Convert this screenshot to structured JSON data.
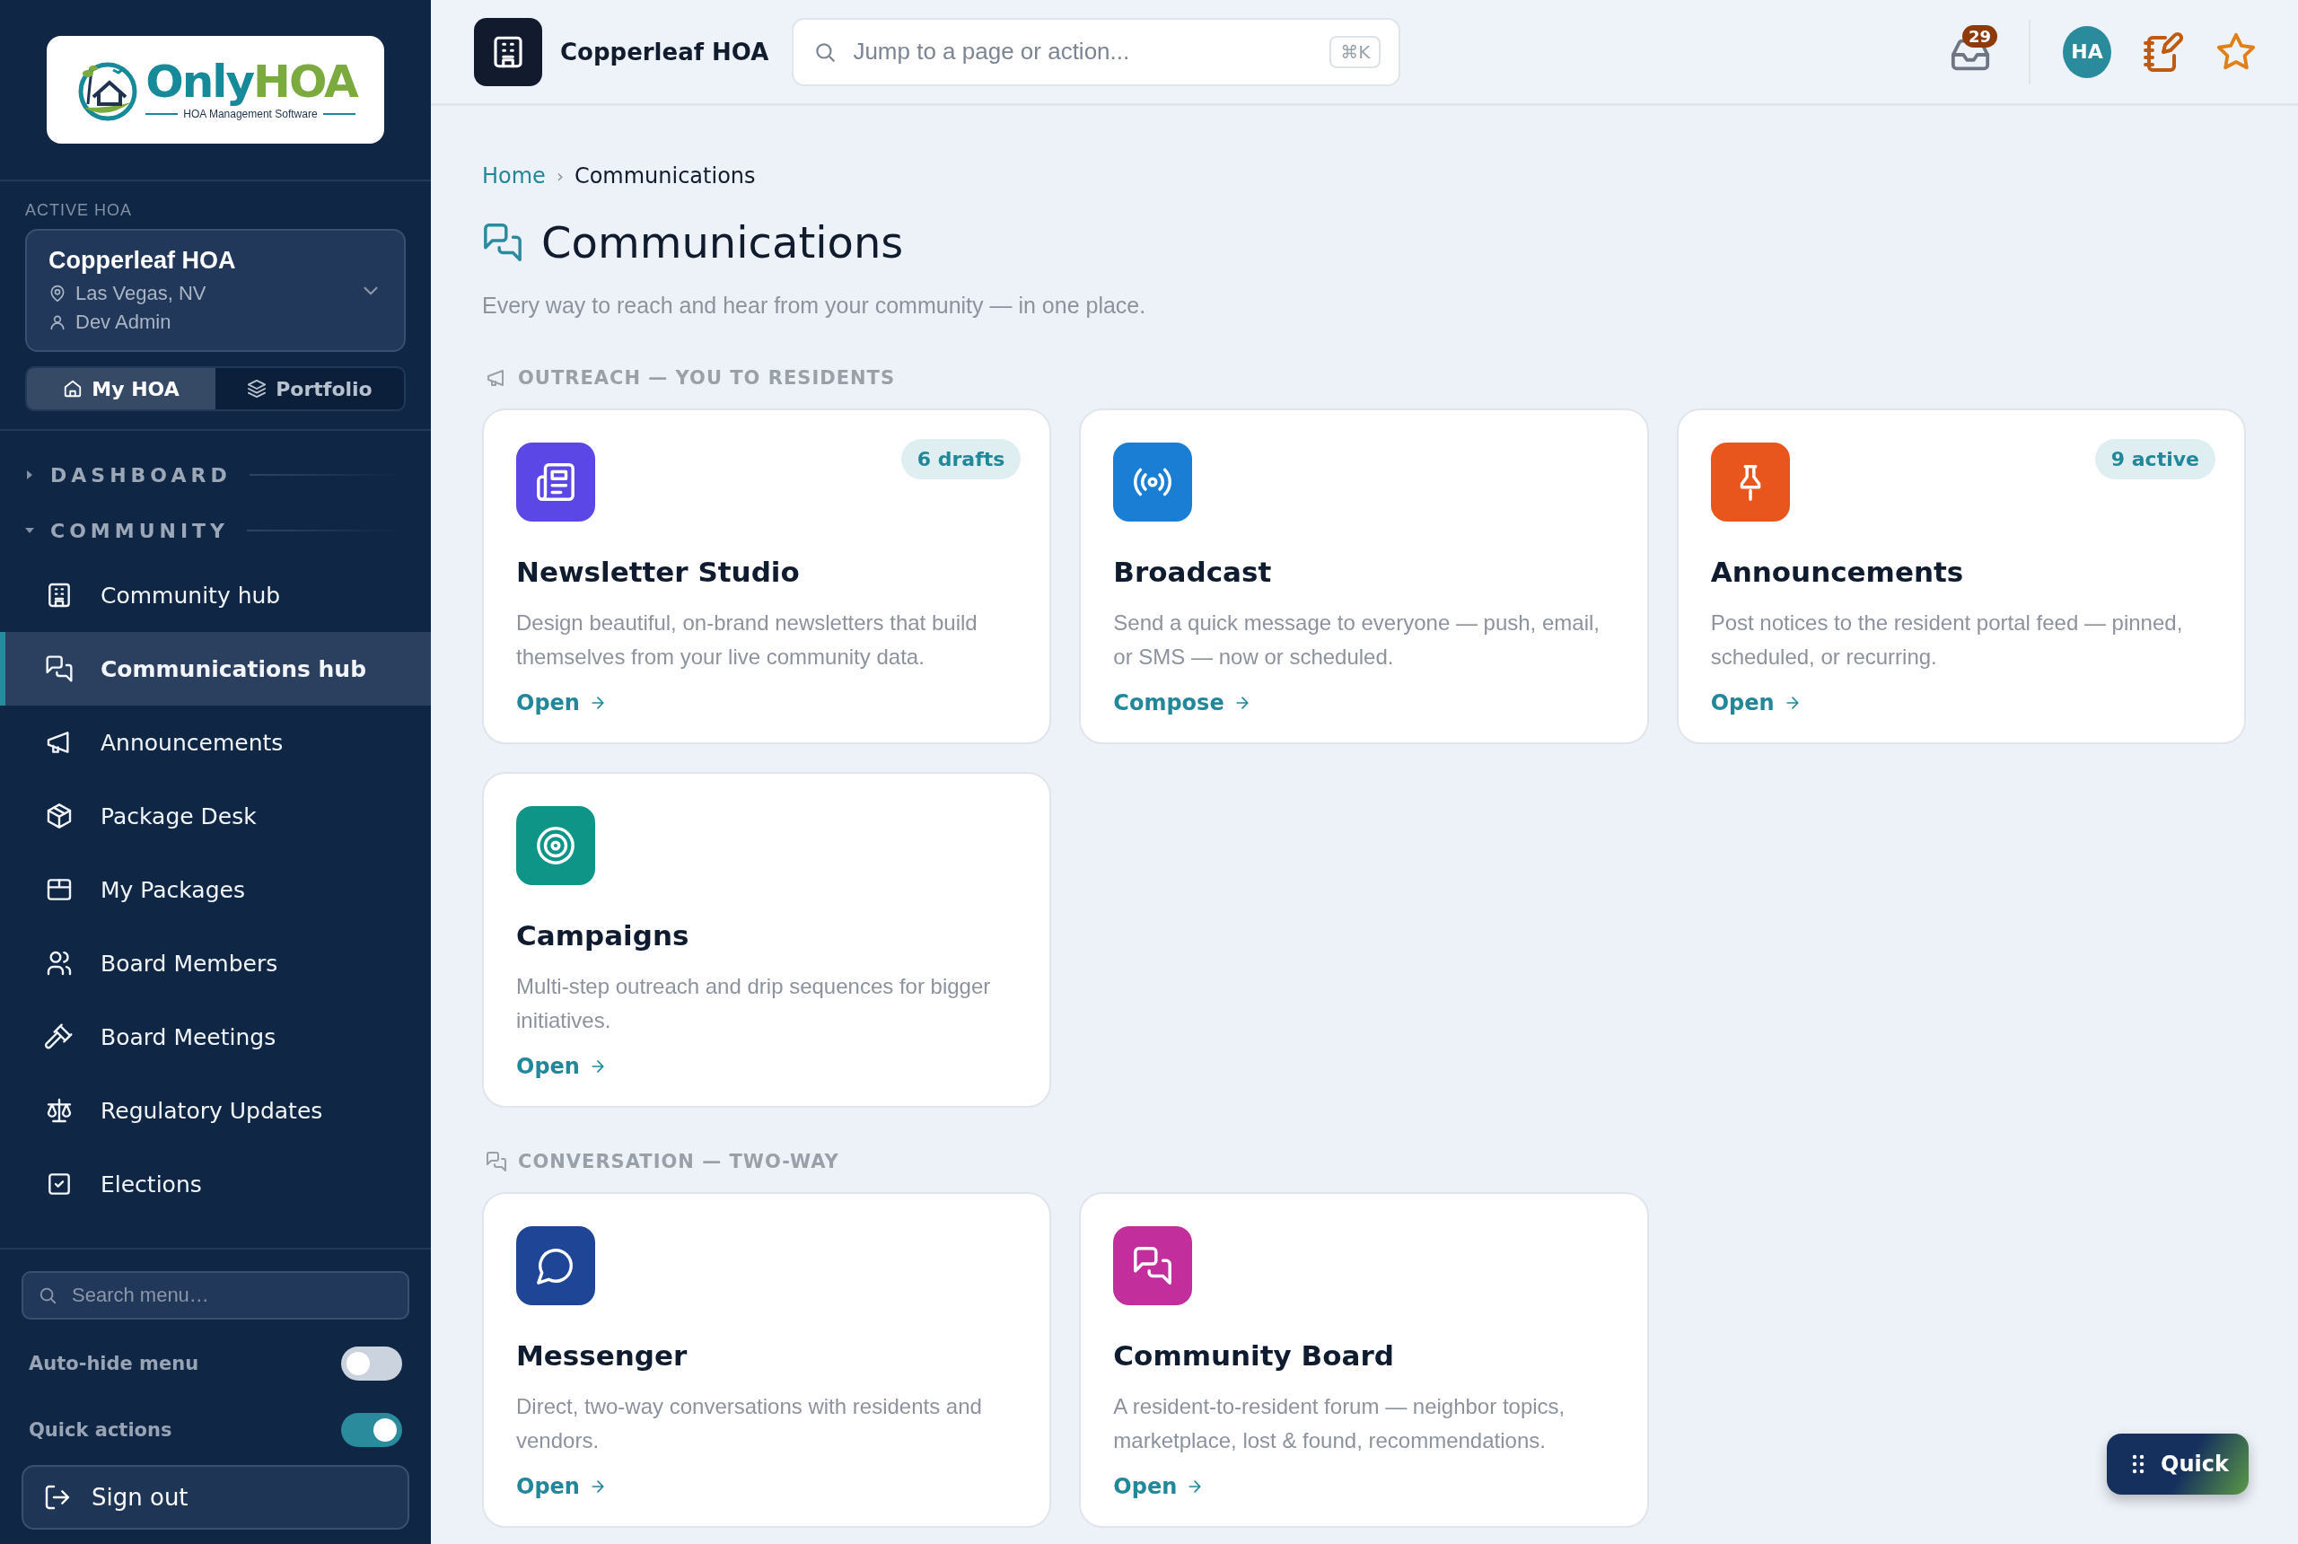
{
  "logo": {
    "wordmark_1": "Only",
    "wordmark_2": "HOA",
    "tagline": "HOA Management Software"
  },
  "active_hoa": {
    "label": "ACTIVE HOA",
    "name": "Copperleaf HOA",
    "location": "Las Vegas, NV",
    "user": "Dev Admin"
  },
  "scope_tabs": [
    {
      "label": "My HOA",
      "kind": "home",
      "selected": true
    },
    {
      "label": "Portfolio",
      "kind": "layers",
      "selected": false
    }
  ],
  "nav_sections": [
    {
      "label": "DASHBOARD",
      "expanded": false
    },
    {
      "label": "COMMUNITY",
      "expanded": true,
      "children": [
        {
          "label": "Community hub",
          "kind": "building",
          "selected": false
        },
        {
          "label": "Communications hub",
          "kind": "chat",
          "selected": true
        },
        {
          "label": "Announcements",
          "kind": "megaphone",
          "selected": false
        },
        {
          "label": "Package Desk",
          "kind": "package",
          "selected": false
        },
        {
          "label": "My Packages",
          "kind": "box",
          "selected": false
        },
        {
          "label": "Board Members",
          "kind": "users",
          "selected": false
        },
        {
          "label": "Board Meetings",
          "kind": "gavel",
          "selected": false
        },
        {
          "label": "Regulatory Updates",
          "kind": "scale",
          "selected": false
        },
        {
          "label": "Elections",
          "kind": "vote",
          "selected": false
        }
      ]
    }
  ],
  "menu_search": {
    "placeholder": "Search menu…"
  },
  "settings": [
    {
      "label": "Auto-hide menu",
      "on": false
    },
    {
      "label": "Quick actions",
      "on": true
    }
  ],
  "sign_out": "Sign out",
  "topbar": {
    "org_name": "Copperleaf HOA",
    "search_placeholder": "Jump to a page or action...",
    "shortcut": "⌘K",
    "inbox_count": "29",
    "avatar": "HA"
  },
  "breadcrumb": {
    "separator": "›",
    "items": [
      {
        "label": "Home"
      },
      {
        "label": "Communications"
      }
    ]
  },
  "page": {
    "title": "Communications",
    "subtitle": "Every way to reach and hear from your community — in one place."
  },
  "sections": [
    {
      "label": "OUTREACH — YOU TO RESIDENTS",
      "kind": "megaphone",
      "cards": [
        {
          "title": "Newsletter Studio",
          "kind": "newspaper",
          "color": "#5b47e6",
          "badge": "6 drafts",
          "description": "Design beautiful, on-brand newsletters that build themselves from your live community data.",
          "action": "Open"
        },
        {
          "title": "Broadcast",
          "kind": "radio",
          "color": "#1a7fd4",
          "description": "Send a quick message to everyone — push, email, or SMS — now or scheduled.",
          "action": "Compose"
        },
        {
          "title": "Announcements",
          "kind": "pin",
          "color": "#e8561e",
          "badge": "9 active",
          "description": "Post notices to the resident portal feed — pinned, scheduled, or recurring.",
          "action": "Open"
        },
        {
          "title": "Campaigns",
          "kind": "target",
          "color": "#0f9488",
          "description": "Multi-step outreach and drip sequences for bigger initiatives.",
          "action": "Open"
        }
      ]
    },
    {
      "label": "CONVERSATION — TWO-WAY",
      "kind": "chat",
      "cards": [
        {
          "title": "Messenger",
          "kind": "message",
          "color": "#1e4596",
          "description": "Direct, two-way conversations with residents and vendors.",
          "action": "Open"
        },
        {
          "title": "Community Board",
          "kind": "chat",
          "color": "#c22f9c",
          "description": "A resident-to-resident forum — neighbor topics, marketplace, lost & found, recommendations.",
          "action": "Open"
        }
      ]
    }
  ],
  "quick_button": "Quick"
}
